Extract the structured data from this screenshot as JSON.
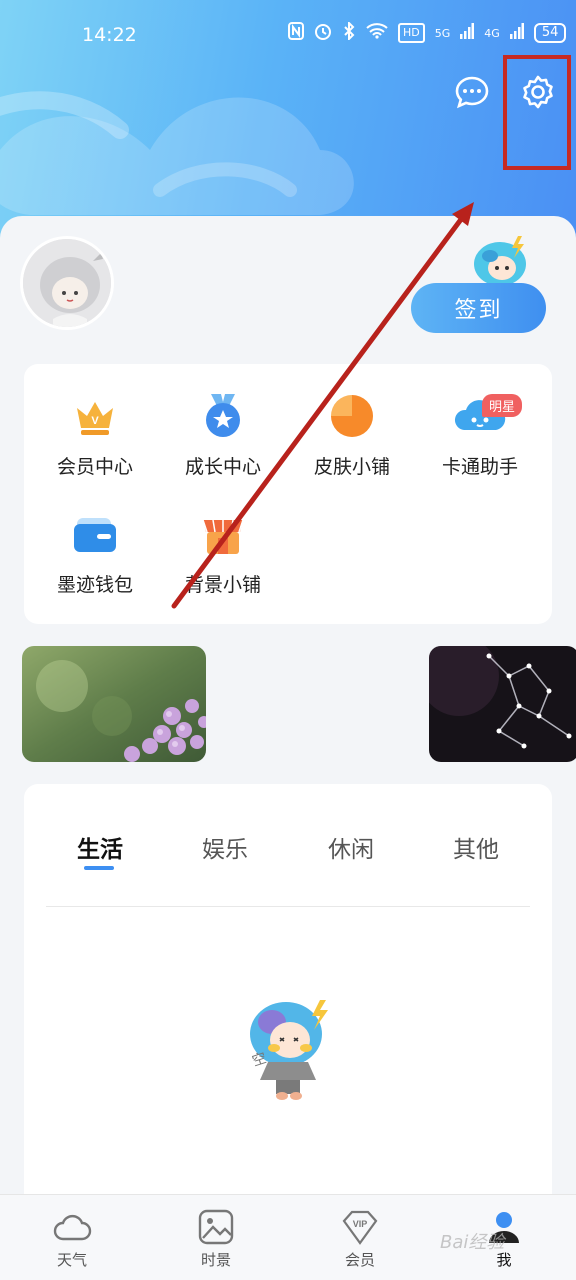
{
  "status_bar": {
    "time": "14:22",
    "network_labels": [
      "HD",
      "5G",
      "4G"
    ],
    "battery": "54"
  },
  "header": {
    "message_icon": "chat-bubble-icon",
    "settings_icon": "gear-icon"
  },
  "profile": {
    "signin_label": "签到"
  },
  "services": {
    "items": [
      {
        "label": "会员中心",
        "icon": "crown-icon"
      },
      {
        "label": "成长中心",
        "icon": "medal-icon"
      },
      {
        "label": "皮肤小铺",
        "icon": "skin-pie-icon"
      },
      {
        "label": "卡通助手",
        "icon": "cartoon-cloud-icon",
        "badge": "明星"
      },
      {
        "label": "墨迹钱包",
        "icon": "wallet-icon"
      },
      {
        "label": "背景小铺",
        "icon": "shop-icon"
      }
    ]
  },
  "tabs": {
    "items": [
      "生活",
      "娱乐",
      "休闲",
      "其他"
    ],
    "active": "生活"
  },
  "empty_state": {
    "stamp_text": "空"
  },
  "bottom_nav": {
    "items": [
      {
        "label": "天气",
        "icon": "cloud-icon"
      },
      {
        "label": "时景",
        "icon": "image-icon"
      },
      {
        "label": "会员",
        "icon": "vip-icon"
      },
      {
        "label": "我",
        "icon": "person-icon"
      }
    ],
    "active": "我"
  },
  "watermark": "Bai经验",
  "colors": {
    "accent": "#3d8ff2",
    "annotation": "#c62a23",
    "badge": "#f06060"
  }
}
